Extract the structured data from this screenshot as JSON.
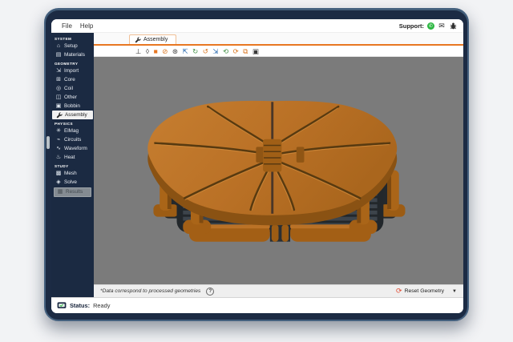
{
  "menu": {
    "items": [
      {
        "label": "File"
      },
      {
        "label": "Help"
      }
    ]
  },
  "support": {
    "label": "Support:",
    "icons": [
      "whatsapp-icon",
      "email-icon",
      "bug-report-icon"
    ],
    "whatsapp_glyph": "✆",
    "email_glyph": "✉"
  },
  "tabs": [
    {
      "label": "Assembly",
      "icon": "wrench-icon",
      "active": true
    }
  ],
  "toolbar": {
    "icons": [
      {
        "name": "axes-icon",
        "glyph": "⊥"
      },
      {
        "name": "droplet-icon",
        "glyph": "◊"
      },
      {
        "name": "color-swatch-icon",
        "glyph": "■"
      },
      {
        "name": "hide-geometry-icon",
        "glyph": "⊘"
      },
      {
        "name": "view-orientation-icon",
        "glyph": "⊛"
      },
      {
        "name": "translate-x-icon",
        "glyph": "⇱"
      },
      {
        "name": "rotate-x-icon",
        "glyph": "↻"
      },
      {
        "name": "rotate-y-icon",
        "glyph": "↺"
      },
      {
        "name": "translate-y-icon",
        "glyph": "⇲"
      },
      {
        "name": "rotate-z-icon",
        "glyph": "⟲"
      },
      {
        "name": "rotate-free-icon",
        "glyph": "⟳"
      },
      {
        "name": "fit-view-icon",
        "glyph": "⧉"
      },
      {
        "name": "screenshot-icon",
        "glyph": "▣"
      }
    ]
  },
  "sidebar": {
    "sections": [
      {
        "header": "SYSTEM",
        "items": [
          {
            "label": "Setup",
            "icon": "home-icon",
            "glyph": "⌂"
          },
          {
            "label": "Materials",
            "icon": "materials-icon",
            "glyph": "▤"
          }
        ]
      },
      {
        "header": "GEOMETRY",
        "items": [
          {
            "label": "Import",
            "icon": "import-icon",
            "glyph": "⇲"
          },
          {
            "label": "Core",
            "icon": "core-icon",
            "glyph": "⊞"
          },
          {
            "label": "Coil",
            "icon": "coil-icon",
            "glyph": "◎"
          },
          {
            "label": "Other",
            "icon": "other-icon",
            "glyph": "◫"
          },
          {
            "label": "Bobbin",
            "icon": "bobbin-icon",
            "glyph": "▣"
          },
          {
            "label": "Assembly",
            "icon": "wrench-icon",
            "glyph": "",
            "selected": true
          }
        ]
      },
      {
        "header": "PHYSICS",
        "items": [
          {
            "label": "ElMag",
            "icon": "elmag-icon",
            "glyph": "✳"
          },
          {
            "label": "Circuits",
            "icon": "circuits-icon",
            "glyph": "⌁"
          },
          {
            "label": "Waveform",
            "icon": "waveform-icon",
            "glyph": "∿"
          },
          {
            "label": "Heat",
            "icon": "heat-icon",
            "glyph": "♨"
          }
        ]
      },
      {
        "header": "STUDY",
        "items": [
          {
            "label": "Mesh",
            "icon": "mesh-icon",
            "glyph": "▩"
          },
          {
            "label": "Solve",
            "icon": "solve-icon",
            "glyph": "◈"
          },
          {
            "label": "Results",
            "icon": "results-icon",
            "glyph": "▦",
            "disabled": true
          }
        ]
      }
    ]
  },
  "viewport": {
    "background": "#7b7b7b",
    "model_description": "Planar transformer assembly: copper petal-segmented top plate over laminated core stack with corner posts"
  },
  "info_bar": {
    "note": "*Data correspond to processed geometries",
    "help_glyph": "?",
    "reset": {
      "label": "Reset Geometry",
      "icon": "reset-refresh-icon",
      "glyph": "⟳"
    },
    "dropdown_glyph": "▼"
  },
  "status_bar": {
    "label": "Status:",
    "value": "Ready"
  },
  "colors": {
    "accent_orange": "#e87722",
    "frame_navy": "#1c2b44",
    "sidebar_navy": "#1b2a42",
    "viewport_gray": "#7b7b7b",
    "model_copper": "#bd7327",
    "whatsapp_green": "#2bb741",
    "reset_red": "#e0482f"
  }
}
